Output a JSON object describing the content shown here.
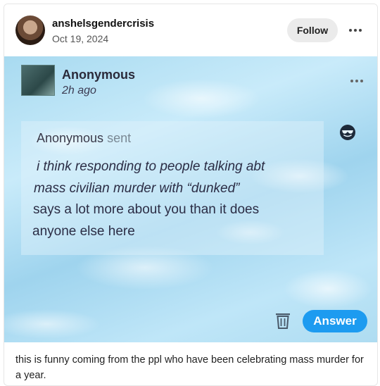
{
  "post": {
    "username": "anshelsgendercrisis",
    "date": "Oct 19, 2024",
    "follow_label": "Follow",
    "caption": "this is funny coming from the ppl who have been celebrating mass murder for a year."
  },
  "ask": {
    "author": "Anonymous",
    "time": "2h ago",
    "sender": "Anonymous",
    "sent_word": "sent",
    "message_lines": [
      "i think responding to people talking abt",
      "mass civilian murder with “dunked”",
      "says a lot more about you than it does",
      " anyone else here"
    ],
    "answer_label": "Answer",
    "icons": {
      "emoji": "sunglasses-emoji-icon",
      "delete": "trash-icon",
      "more": "more-options-icon"
    }
  },
  "colors": {
    "accent": "#1d9bf0",
    "ask_background": "#b5e1f5"
  }
}
